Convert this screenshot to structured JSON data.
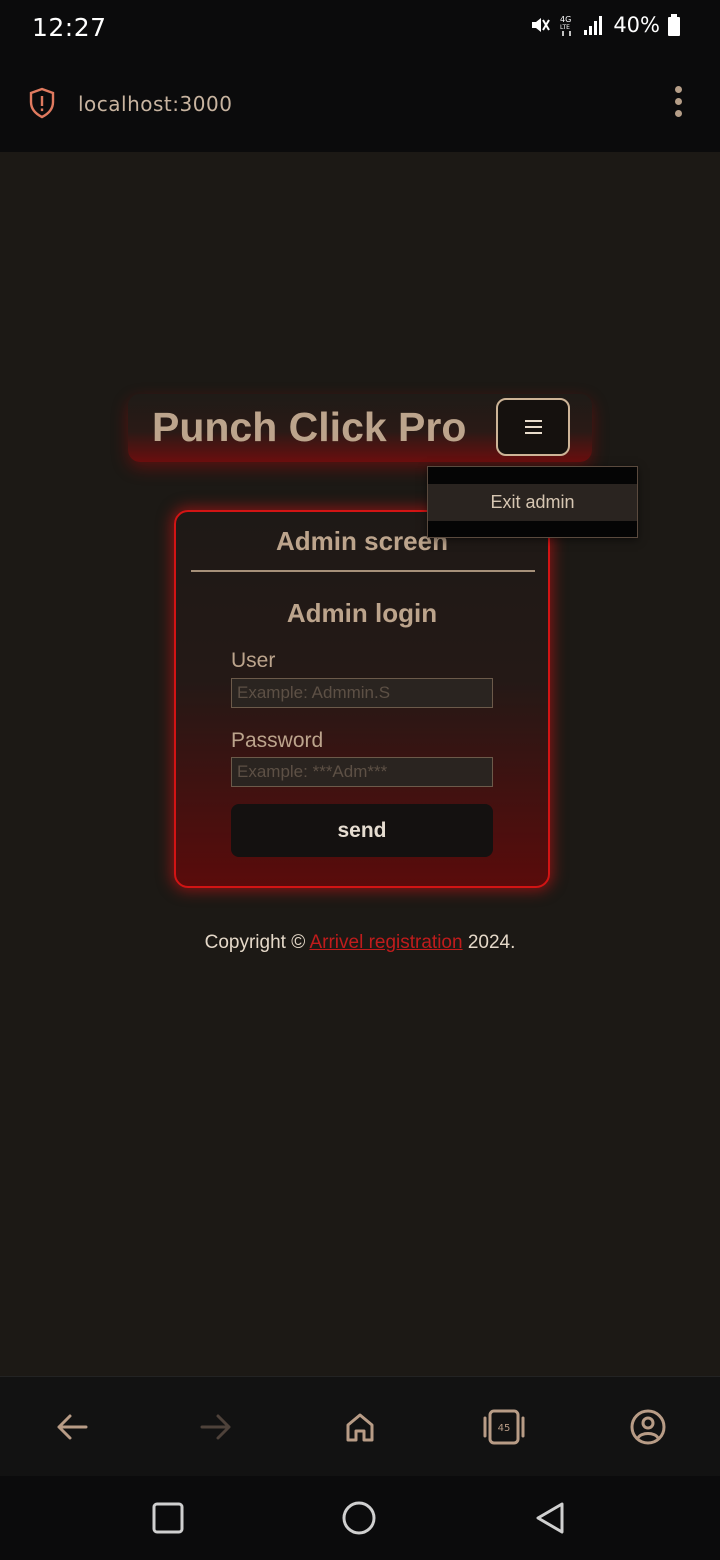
{
  "status_bar": {
    "time": "12:27",
    "network": "4G LTE",
    "battery": "40%",
    "icons": [
      "mute-icon",
      "data-icon",
      "signal-icon",
      "battery-icon"
    ]
  },
  "browser": {
    "url": "localhost:3000",
    "security_icon": "shield-alert-icon",
    "menu_icon": "kebab-menu-icon",
    "tab_count": "45",
    "bottom_nav_icons": [
      "back-arrow-icon",
      "forward-arrow-icon",
      "home-icon",
      "tabs-icon",
      "account-icon"
    ]
  },
  "header": {
    "title": "Punch Click Pro",
    "menu_icon": "hamburger-icon"
  },
  "dropdown": {
    "items": [
      {
        "label": "Exit admin"
      }
    ]
  },
  "card": {
    "title": "Admin screen",
    "subtitle": "Admin login",
    "user_label": "User",
    "user_placeholder": "Example: Admmin.S",
    "password_label": "Password",
    "password_placeholder": "Example: ***Adm***",
    "send_label": "send"
  },
  "footer": {
    "prefix": "Copyright ©",
    "link_text": "Arrivel registration",
    "suffix": "2024."
  },
  "colors": {
    "accent_red": "#d21414",
    "text_tan": "#bca48c",
    "background": "#1c1915"
  },
  "android_nav_icons": [
    "recents-square-icon",
    "home-circle-icon",
    "back-triangle-icon"
  ]
}
